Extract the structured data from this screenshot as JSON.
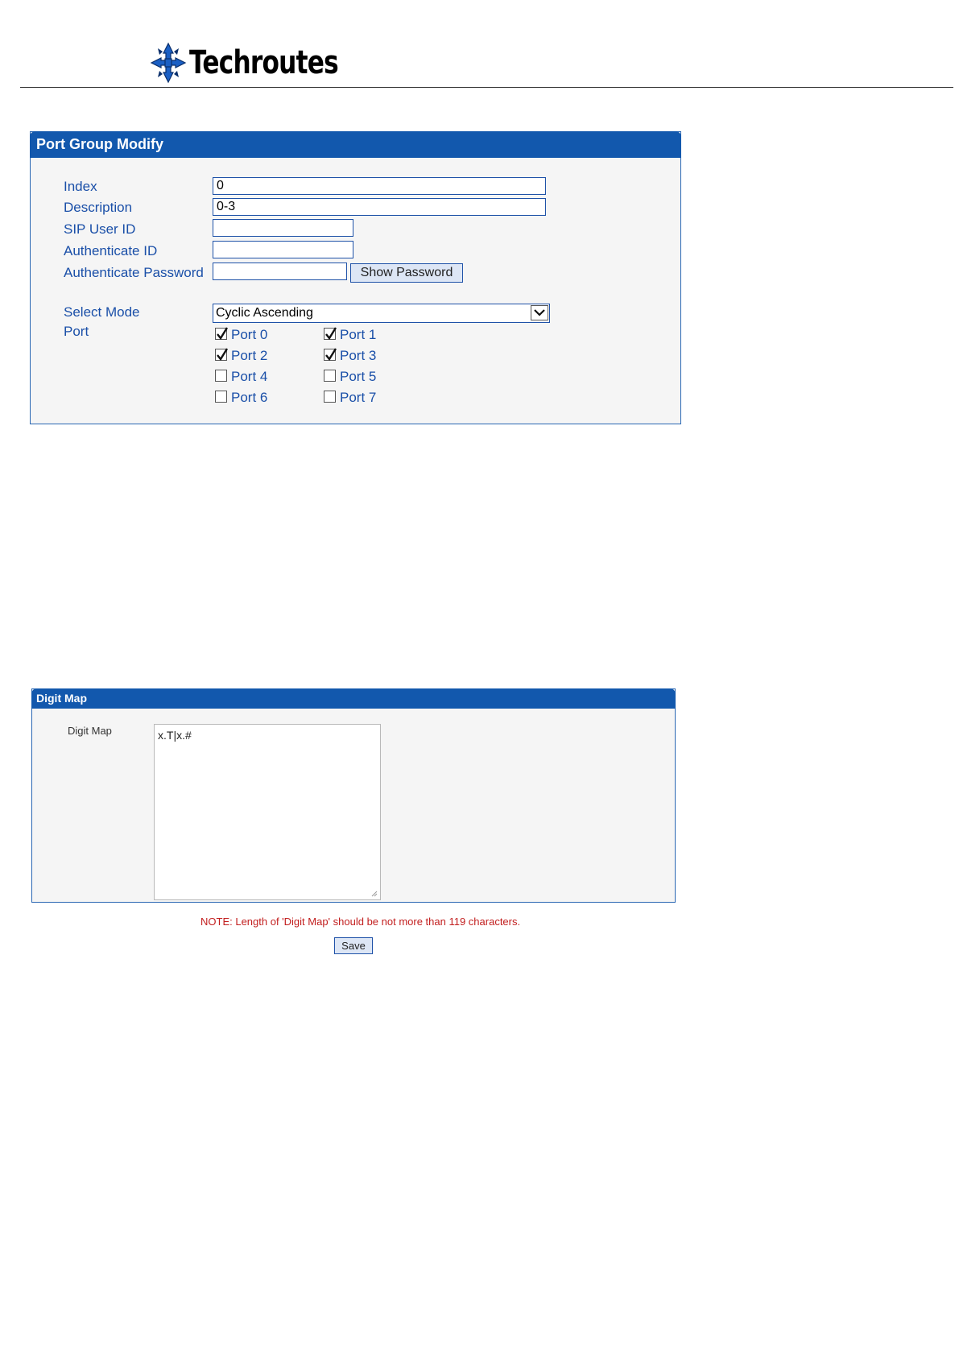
{
  "header": {
    "brand": "Techroutes"
  },
  "port_group": {
    "title": "Port Group Modify",
    "index_label": "Index",
    "index_value": "0",
    "description_label": "Description",
    "description_value": "0-3",
    "sip_user_label": "SIP User ID",
    "sip_user_value": "",
    "auth_id_label": "Authenticate ID",
    "auth_id_value": "",
    "auth_pwd_label": "Authenticate Password",
    "auth_pwd_value": "",
    "show_password_label": "Show Password",
    "select_mode_label": "Select Mode",
    "select_mode_value": "Cyclic Ascending",
    "port_label": "Port",
    "ports": [
      {
        "label": "Port 0",
        "checked": true
      },
      {
        "label": "Port 1",
        "checked": true
      },
      {
        "label": "Port 2",
        "checked": true
      },
      {
        "label": "Port 3",
        "checked": true
      },
      {
        "label": "Port 4",
        "checked": false
      },
      {
        "label": "Port 5",
        "checked": false
      },
      {
        "label": "Port 6",
        "checked": false
      },
      {
        "label": "Port 7",
        "checked": false
      }
    ]
  },
  "digit_map": {
    "title": "Digit Map",
    "label": "Digit Map",
    "value": "x.T|x.#",
    "note": "NOTE: Length of 'Digit Map' should be not more than 119 characters.",
    "save_label": "Save"
  },
  "colors": {
    "panel_header": "#1258ad",
    "label_text": "#1a4fa8",
    "note_text": "#c21e1e"
  },
  "icons": {
    "logo": "compass-cross-icon",
    "checkmark": "checkmark-icon",
    "dropdown": "chevron-down-icon",
    "resize": "resize-grip-icon"
  }
}
